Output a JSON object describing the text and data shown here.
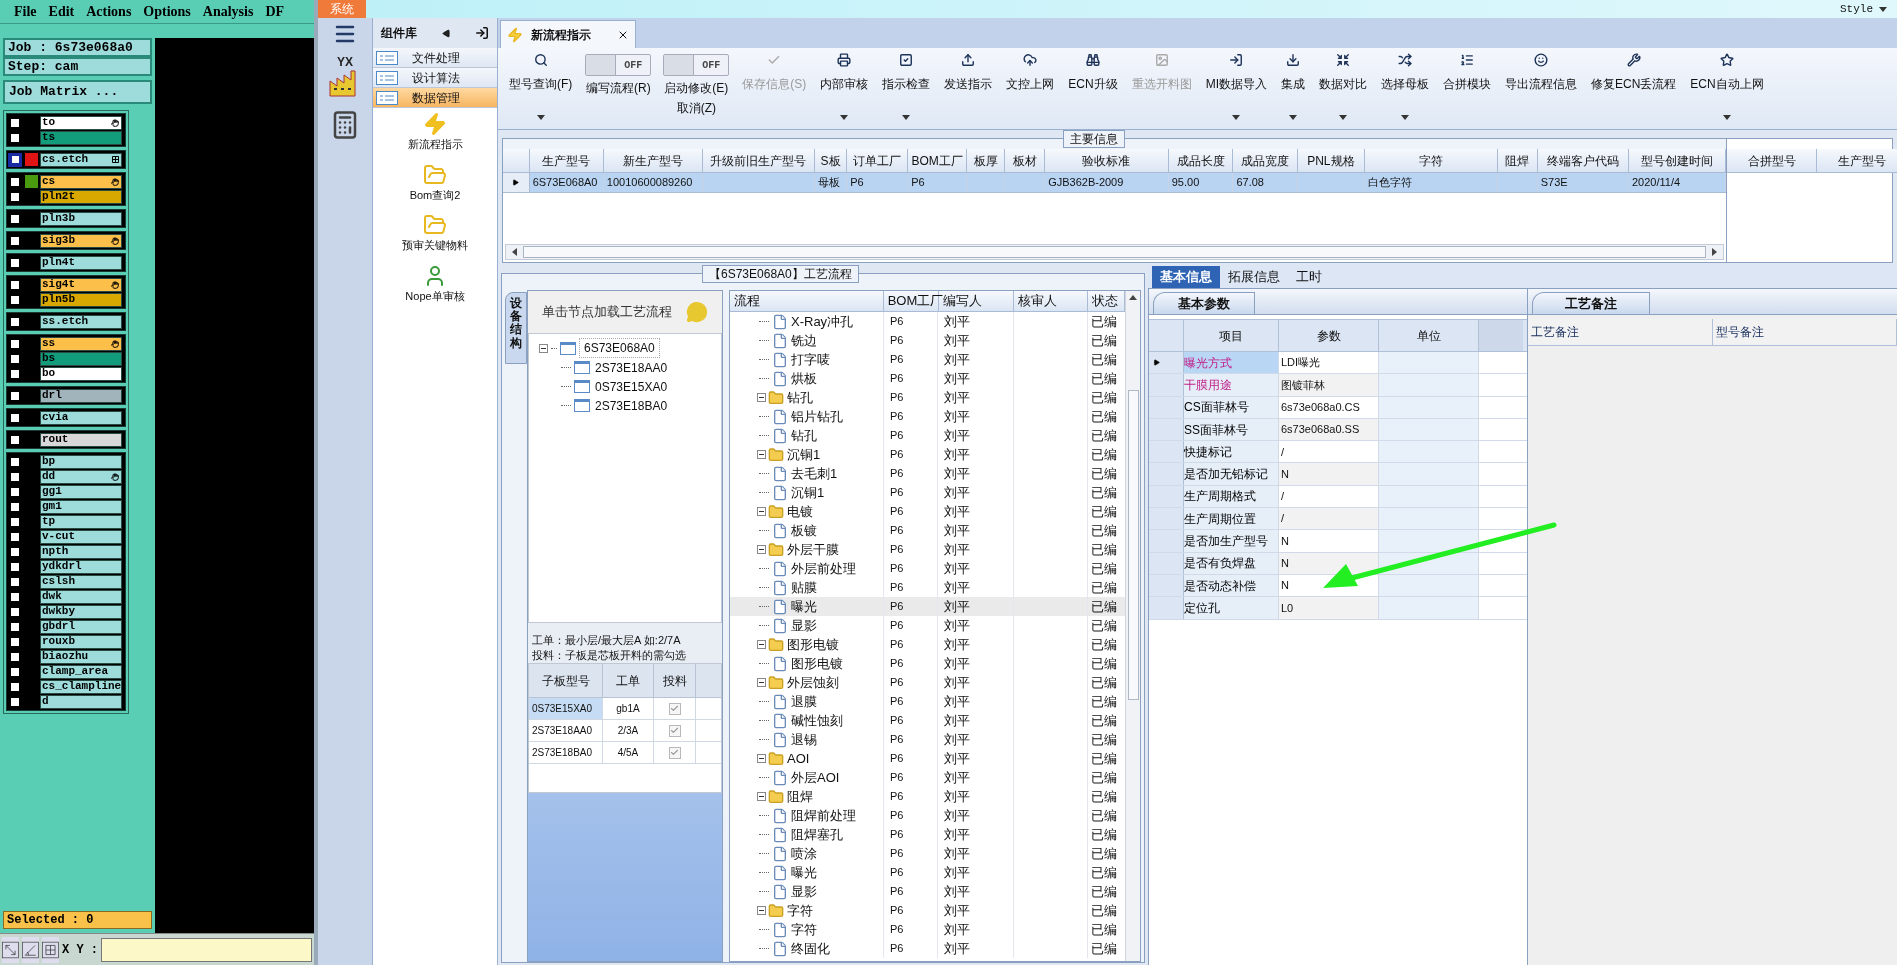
{
  "cam": {
    "menu": [
      "File",
      "Edit",
      "Actions",
      "Options",
      "Analysis",
      "DF"
    ],
    "job": "Job : 6s73e068a0",
    "step": "Step: cam",
    "matrix_button": "Job Matrix ...",
    "layer_groups": [
      [
        {
          "name": "to",
          "color": "#ffffff",
          "flagged": true,
          "grid_mark": false,
          "selected": false
        },
        {
          "name": "ts",
          "color": "#139c7c",
          "flagged": false,
          "grid_mark": false,
          "selected": false
        }
      ],
      [
        {
          "name": "cs.etch",
          "color": "#9edcdc",
          "flagged": false,
          "grid_mark": true,
          "swatch": {
            "color": "#e01414"
          },
          "selected": true
        }
      ],
      [
        {
          "name": "cs",
          "color": "#fbbf4a",
          "flagged": true,
          "grid_mark": false,
          "swatch": {
            "color": "#4a9a10"
          },
          "selected": false
        },
        {
          "name": "pln2t",
          "color": "#d9a800",
          "flagged": false,
          "grid_mark": false,
          "selected": false
        }
      ],
      [
        {
          "name": "pln3b",
          "color": "#9edcdc",
          "flagged": false,
          "grid_mark": false,
          "selected": false
        }
      ],
      [
        {
          "name": "sig3b",
          "color": "#fbbf4a",
          "flagged": true,
          "grid_mark": false,
          "selected": false
        }
      ],
      [
        {
          "name": "pln4t",
          "color": "#9edcdc",
          "flagged": false,
          "grid_mark": false,
          "selected": false
        }
      ],
      [
        {
          "name": "sig4t",
          "color": "#fbbf4a",
          "flagged": true,
          "grid_mark": false,
          "selected": false
        },
        {
          "name": "pln5b",
          "color": "#d9a800",
          "flagged": false,
          "grid_mark": false,
          "selected": false
        }
      ],
      [
        {
          "name": "ss.etch",
          "color": "#9edcdc",
          "flagged": false,
          "grid_mark": false,
          "selected": false
        }
      ],
      [
        {
          "name": "ss",
          "color": "#fbbf4a",
          "flagged": true,
          "grid_mark": false,
          "selected": false
        },
        {
          "name": "bs",
          "color": "#139c7c",
          "flagged": false,
          "grid_mark": false,
          "selected": false
        },
        {
          "name": "bo",
          "color": "#ffffff",
          "flagged": false,
          "grid_mark": false,
          "selected": false
        }
      ],
      [
        {
          "name": "drl",
          "color": "#a2b4bb",
          "flagged": false,
          "grid_mark": false,
          "selected": false
        }
      ],
      [
        {
          "name": "cvia",
          "color": "#9edcdc",
          "flagged": false,
          "grid_mark": false,
          "selected": false
        }
      ],
      [
        {
          "name": "rout",
          "color": "#d8d8d8",
          "flagged": false,
          "grid_mark": false,
          "selected": false
        }
      ],
      [
        {
          "name": "bp",
          "color": "#9edcdc",
          "flagged": false,
          "grid_mark": false,
          "selected": false
        },
        {
          "name": "dd",
          "color": "#9edcdc",
          "flagged": true,
          "grid_mark": false,
          "selected": false
        },
        {
          "name": "gg1",
          "color": "#9edcdc",
          "flagged": false,
          "grid_mark": false,
          "selected": false
        },
        {
          "name": "gm1",
          "color": "#9edcdc",
          "flagged": false,
          "grid_mark": false,
          "selected": false
        },
        {
          "name": "tp",
          "color": "#9edcdc",
          "flagged": false,
          "grid_mark": false,
          "selected": false
        },
        {
          "name": "v-cut",
          "color": "#9edcdc",
          "flagged": false,
          "grid_mark": false,
          "selected": false
        },
        {
          "name": "npth",
          "color": "#9edcdc",
          "flagged": false,
          "grid_mark": false,
          "selected": false
        },
        {
          "name": "ydkdrl",
          "color": "#9edcdc",
          "flagged": false,
          "grid_mark": false,
          "selected": false
        },
        {
          "name": "cslsh",
          "color": "#9edcdc",
          "flagged": false,
          "grid_mark": false,
          "selected": false
        },
        {
          "name": "dwk",
          "color": "#9edcdc",
          "flagged": false,
          "grid_mark": false,
          "selected": false
        },
        {
          "name": "dwkby",
          "color": "#9edcdc",
          "flagged": false,
          "grid_mark": false,
          "selected": false
        },
        {
          "name": "gbdrl",
          "color": "#9edcdc",
          "flagged": false,
          "grid_mark": false,
          "selected": false
        },
        {
          "name": "rouxb",
          "color": "#9edcdc",
          "flagged": false,
          "grid_mark": false,
          "selected": false
        },
        {
          "name": "biaozhu",
          "color": "#9edcdc",
          "flagged": false,
          "grid_mark": false,
          "selected": false
        },
        {
          "name": "clamp_area",
          "color": "#9edcdc",
          "flagged": false,
          "grid_mark": false,
          "selected": false
        },
        {
          "name": "cs_clampline",
          "color": "#9edcdc",
          "flagged": false,
          "grid_mark": false,
          "selected": false
        },
        {
          "name": "d",
          "color": "#9edcdc",
          "flagged": false,
          "grid_mark": false,
          "selected": false
        }
      ]
    ],
    "selected_count": "Selected : 0",
    "xy_label": "X Y :"
  },
  "app": {
    "system_tab": "系统",
    "style_menu": "Style",
    "logo_text": "YX",
    "sidebar": {
      "title": "组件库",
      "modules": [
        {
          "label": "文件处理",
          "selected": false
        },
        {
          "label": "设计算法",
          "selected": false
        },
        {
          "label": "数据管理",
          "selected": true
        }
      ],
      "tools": [
        {
          "label": "新流程指示",
          "kind": "lightning"
        },
        {
          "label": "Bom查询2",
          "kind": "folder"
        },
        {
          "label": "预审关键物料",
          "kind": "folder"
        },
        {
          "label": "Nope单审核",
          "kind": "person"
        }
      ]
    },
    "doc_tab": {
      "label": "新流程指示"
    },
    "toolbar": [
      {
        "kind": "button",
        "label": "型号查询(F)",
        "dropdown": true,
        "disabled": false
      },
      {
        "kind": "toggle",
        "label": "编写流程(R)",
        "state_text": "OFF",
        "on": false
      },
      {
        "kind": "toggle",
        "label": "启动修改(E)",
        "sublabel": "取消(Z)",
        "state_text": "OFF",
        "on": false
      },
      {
        "kind": "button",
        "label": "保存信息(S)",
        "dropdown": false,
        "disabled": true
      },
      {
        "kind": "button",
        "label": "内部审核",
        "dropdown": true,
        "disabled": false
      },
      {
        "kind": "button",
        "label": "指示检查",
        "dropdown": true,
        "disabled": false
      },
      {
        "kind": "button",
        "label": "发送指示",
        "dropdown": false,
        "disabled": false
      },
      {
        "kind": "button",
        "label": "文控上网",
        "dropdown": false,
        "disabled": false
      },
      {
        "kind": "button",
        "label": "ECN升级",
        "dropdown": false,
        "disabled": false
      },
      {
        "kind": "button",
        "label": "重选开料图",
        "dropdown": false,
        "disabled": true
      },
      {
        "kind": "button",
        "label": "MI数据导入",
        "dropdown": true,
        "disabled": false
      },
      {
        "kind": "button",
        "label": "集成",
        "dropdown": true,
        "disabled": false
      },
      {
        "kind": "button",
        "label": "数据对比",
        "dropdown": true,
        "disabled": false
      },
      {
        "kind": "button",
        "label": "选择母板",
        "dropdown": true,
        "disabled": false
      },
      {
        "kind": "button",
        "label": "合拼模块",
        "dropdown": false,
        "disabled": false
      },
      {
        "kind": "button",
        "label": "导出流程信息",
        "dropdown": false,
        "disabled": false
      },
      {
        "kind": "button",
        "label": "修复ECN丢流程",
        "dropdown": false,
        "disabled": false
      },
      {
        "kind": "button",
        "label": "ECN自动上网",
        "dropdown": true,
        "disabled": false
      }
    ]
  },
  "main_info": {
    "title": "主要信息",
    "columns": [
      "生产型号",
      "新生产型号",
      "升级前旧生产型号",
      "S板",
      "订单工厂",
      "BOM工厂",
      "板厚",
      "板材",
      "验收标准",
      "成品长度",
      "成品宽度",
      "PNL规格",
      "字符",
      "阻焊",
      "终端客户代码",
      "型号创建时间"
    ],
    "rows": [
      {
        "selected": true,
        "cells": [
          "6S73E068A0",
          "10010600089260",
          null,
          "母板",
          "P6",
          "P6",
          null,
          null,
          "GJB362B-2009",
          "95.00",
          "67.08",
          null,
          "白色字符",
          null,
          "S73E",
          "2020/11/4"
        ]
      }
    ],
    "merge_columns": [
      "合拼型号",
      "生产型号"
    ]
  },
  "process": {
    "title": "【6S73E068A0】工艺流程",
    "side_tab": "设备结构",
    "hint": "单击节点加载工艺流程",
    "tree": [
      {
        "label": "6S73E068A0",
        "expanded": true,
        "children": [
          {
            "label": "2S73E18AA0"
          },
          {
            "label": "0S73E15XA0"
          },
          {
            "label": "2S73E18BA0"
          }
        ]
      }
    ],
    "notes": [
      "工单：最小层/最大层A 如:2/7A",
      "投料：子板是芯板开料的需勾选"
    ],
    "sub_table": {
      "columns": [
        "子板型号",
        "工单",
        "投料"
      ],
      "rows": [
        {
          "cells": [
            "0S73E15XA0",
            "gb1A"
          ],
          "checked": true,
          "selected": true
        },
        {
          "cells": [
            "2S73E18AA0",
            "2/3A"
          ],
          "checked": true,
          "selected": false
        },
        {
          "cells": [
            "2S73E18BA0",
            "4/5A"
          ],
          "checked": true,
          "selected": false
        }
      ]
    },
    "grid": {
      "columns": [
        "流程",
        "BOM工厂",
        "编写人",
        "核审人",
        "状态"
      ],
      "rows": [
        {
          "kind": "step",
          "name": "X-Ray冲孔",
          "bom": "P6",
          "writer": "刘平",
          "status": "已编",
          "selected": false
        },
        {
          "kind": "step",
          "name": "铣边",
          "bom": "P6",
          "writer": "刘平",
          "status": "已编",
          "selected": false
        },
        {
          "kind": "step",
          "name": "打字唛",
          "bom": "P6",
          "writer": "刘平",
          "status": "已编",
          "selected": false
        },
        {
          "kind": "step",
          "name": "烘板",
          "bom": "P6",
          "writer": "刘平",
          "status": "已编",
          "selected": false
        },
        {
          "kind": "folder",
          "name": "钻孔",
          "bom": "P6",
          "writer": "刘平",
          "status": "已编",
          "expanded": true,
          "selected": false,
          "children": [
            {
              "kind": "step",
              "name": "铝片钻孔",
              "bom": "P6",
              "writer": "刘平",
              "status": "已编",
              "selected": false
            },
            {
              "kind": "step",
              "name": "钻孔",
              "bom": "P6",
              "writer": "刘平",
              "status": "已编",
              "selected": false
            }
          ]
        },
        {
          "kind": "folder",
          "name": "沉铜1",
          "bom": "P6",
          "writer": "刘平",
          "status": "已编",
          "expanded": true,
          "selected": false,
          "children": [
            {
              "kind": "step",
              "name": "去毛刺1",
              "bom": "P6",
              "writer": "刘平",
              "status": "已编",
              "selected": false
            },
            {
              "kind": "step",
              "name": "沉铜1",
              "bom": "P6",
              "writer": "刘平",
              "status": "已编",
              "selected": false
            }
          ]
        },
        {
          "kind": "folder",
          "name": "电镀",
          "bom": "P6",
          "writer": "刘平",
          "status": "已编",
          "expanded": true,
          "selected": false,
          "children": [
            {
              "kind": "step",
              "name": "板镀",
              "bom": "P6",
              "writer": "刘平",
              "status": "已编",
              "selected": false
            }
          ]
        },
        {
          "kind": "folder",
          "name": "外层干膜",
          "bom": "P6",
          "writer": "刘平",
          "status": "已编",
          "expanded": true,
          "selected": false,
          "children": [
            {
              "kind": "step",
              "name": "外层前处理",
              "bom": "P6",
              "writer": "刘平",
              "status": "已编",
              "selected": false
            },
            {
              "kind": "step",
              "name": "贴膜",
              "bom": "P6",
              "writer": "刘平",
              "status": "已编",
              "selected": false
            },
            {
              "kind": "step",
              "name": "曝光",
              "bom": "P6",
              "writer": "刘平",
              "status": "已编",
              "selected": true
            },
            {
              "kind": "step",
              "name": "显影",
              "bom": "P6",
              "writer": "刘平",
              "status": "已编",
              "selected": false
            }
          ]
        },
        {
          "kind": "folder",
          "name": "图形电镀",
          "bom": "P6",
          "writer": "刘平",
          "status": "已编",
          "expanded": true,
          "selected": false,
          "children": [
            {
              "kind": "step",
              "name": "图形电镀",
              "bom": "P6",
              "writer": "刘平",
              "status": "已编",
              "selected": false
            }
          ]
        },
        {
          "kind": "folder",
          "name": "外层蚀刻",
          "bom": "P6",
          "writer": "刘平",
          "status": "已编",
          "expanded": true,
          "selected": false,
          "children": [
            {
              "kind": "step",
              "name": "退膜",
              "bom": "P6",
              "writer": "刘平",
              "status": "已编",
              "selected": false
            },
            {
              "kind": "step",
              "name": "碱性蚀刻",
              "bom": "P6",
              "writer": "刘平",
              "status": "已编",
              "selected": false
            },
            {
              "kind": "step",
              "name": "退锡",
              "bom": "P6",
              "writer": "刘平",
              "status": "已编",
              "selected": false
            }
          ]
        },
        {
          "kind": "folder",
          "name": "AOI",
          "bom": "P6",
          "writer": "刘平",
          "status": "已编",
          "expanded": true,
          "selected": false,
          "children": [
            {
              "kind": "step",
              "name": "外层AOI",
              "bom": "P6",
              "writer": "刘平",
              "status": "已编",
              "selected": false
            }
          ]
        },
        {
          "kind": "folder",
          "name": "阻焊",
          "bom": "P6",
          "writer": "刘平",
          "status": "已编",
          "expanded": true,
          "selected": false,
          "children": [
            {
              "kind": "step",
              "name": "阻焊前处理",
              "bom": "P6",
              "writer": "刘平",
              "status": "已编",
              "selected": false
            },
            {
              "kind": "step",
              "name": "阻焊塞孔",
              "bom": "P6",
              "writer": "刘平",
              "status": "已编",
              "selected": false
            },
            {
              "kind": "step",
              "name": "喷涂",
              "bom": "P6",
              "writer": "刘平",
              "status": "已编",
              "selected": false
            },
            {
              "kind": "step",
              "name": "曝光",
              "bom": "P6",
              "writer": "刘平",
              "status": "已编",
              "selected": false
            },
            {
              "kind": "step",
              "name": "显影",
              "bom": "P6",
              "writer": "刘平",
              "status": "已编",
              "selected": false
            }
          ]
        },
        {
          "kind": "folder",
          "name": "字符",
          "bom": "P6",
          "writer": "刘平",
          "status": "已编",
          "expanded": true,
          "selected": false,
          "children": [
            {
              "kind": "step",
              "name": "字符",
              "bom": "P6",
              "writer": "刘平",
              "status": "已编",
              "selected": false
            },
            {
              "kind": "step",
              "name": "终固化",
              "bom": "P6",
              "writer": "刘平",
              "status": "已编",
              "selected": false
            }
          ]
        }
      ]
    }
  },
  "details": {
    "tabs": [
      {
        "label": "基本信息",
        "selected": true
      },
      {
        "label": "拓展信息",
        "selected": false
      },
      {
        "label": "工时",
        "selected": false
      }
    ],
    "params": {
      "tab": "基本参数",
      "columns": [
        "项目",
        "参数",
        "单位"
      ],
      "rows": [
        {
          "item": "曝光方式",
          "value": "LDI曝光",
          "required": true,
          "selected": true
        },
        {
          "item": "干膜用途",
          "value": "图镀菲林",
          "required": true,
          "selected": false
        },
        {
          "item": "CS面菲林号",
          "value": "6s73e068a0.CS",
          "required": false,
          "selected": false
        },
        {
          "item": "SS面菲林号",
          "value": "6s73e068a0.SS",
          "required": false,
          "selected": false
        },
        {
          "item": "快捷标记",
          "value": "/",
          "required": false,
          "selected": false
        },
        {
          "item": "是否加无铅标记",
          "value": "N",
          "required": false,
          "selected": false
        },
        {
          "item": "生产周期格式",
          "value": "/",
          "required": false,
          "selected": false
        },
        {
          "item": "生产周期位置",
          "value": "/",
          "required": false,
          "selected": false
        },
        {
          "item": "是否加生产型号",
          "value": "N",
          "required": false,
          "selected": false
        },
        {
          "item": "是否有负焊盘",
          "value": "N",
          "required": false,
          "selected": false
        },
        {
          "item": "是否动态补偿",
          "value": "N",
          "required": false,
          "selected": false
        },
        {
          "item": "定位孔",
          "value": "L0",
          "required": false,
          "selected": false
        }
      ]
    },
    "remarks": {
      "tab": "工艺备注",
      "columns": [
        "工艺备注",
        "型号备注"
      ]
    }
  }
}
